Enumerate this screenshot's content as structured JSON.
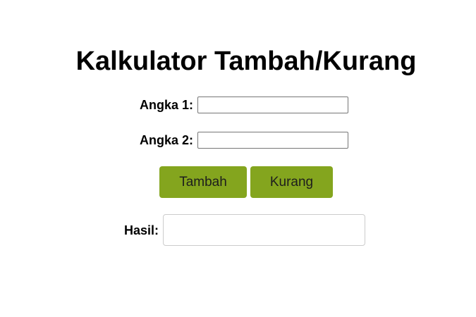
{
  "title": "Kalkulator Tambah/Kurang",
  "form": {
    "angka1": {
      "label": "Angka 1:",
      "value": ""
    },
    "angka2": {
      "label": "Angka 2:",
      "value": ""
    }
  },
  "buttons": {
    "tambah": "Tambah",
    "kurang": "Kurang"
  },
  "result": {
    "label": "Hasil:",
    "value": ""
  },
  "colors": {
    "button_bg": "#84a51e",
    "button_text": "#1d1d1d"
  }
}
